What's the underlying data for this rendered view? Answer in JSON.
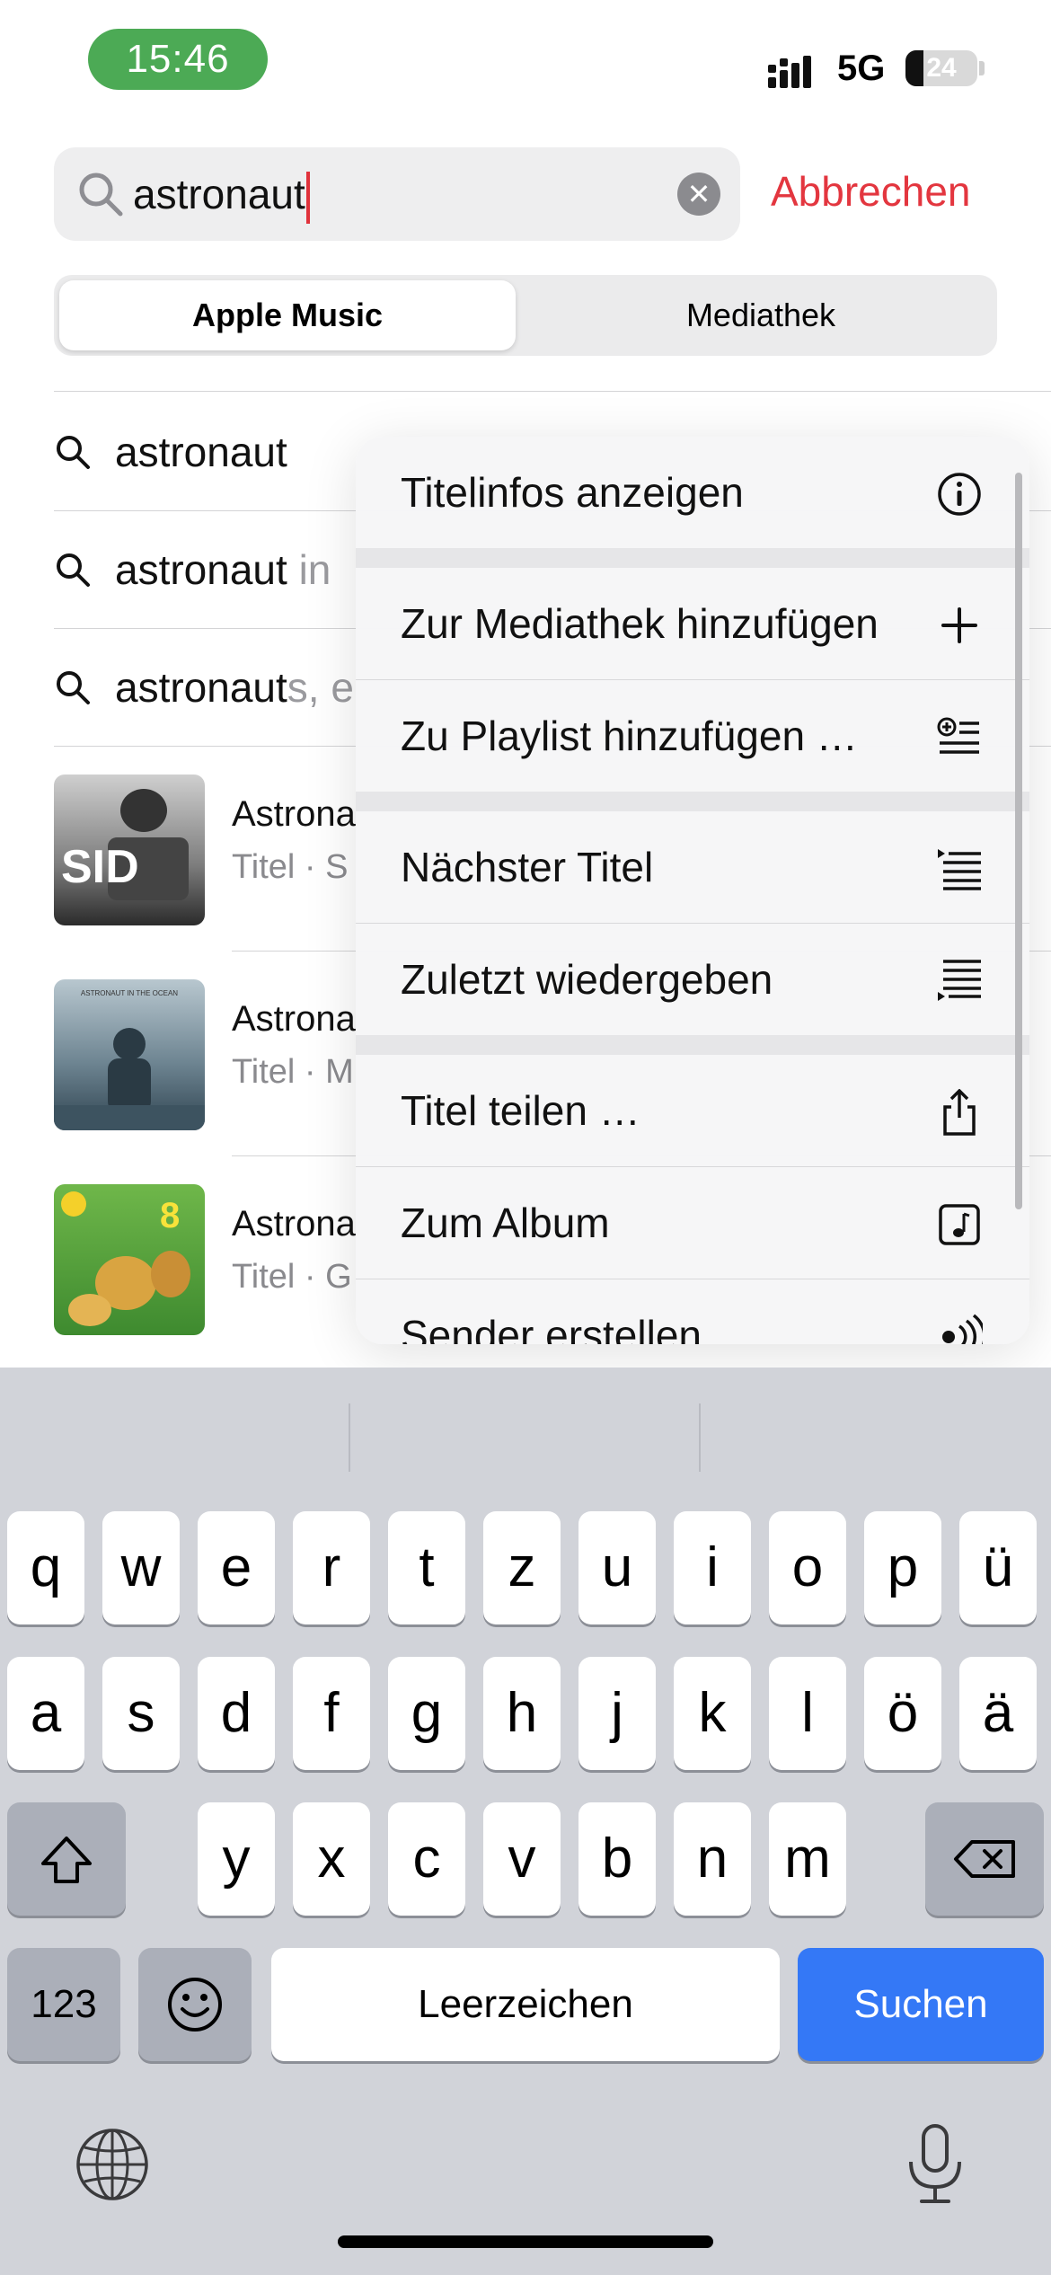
{
  "status_bar": {
    "time": "15:46",
    "network": "5G",
    "battery": "24"
  },
  "search": {
    "value": "astronaut",
    "clear_icon": "clear-icon",
    "cancel_label": "Abbrechen"
  },
  "segments": {
    "active": "Apple Music",
    "inactive": "Mediathek"
  },
  "suggestions": [
    {
      "match": "astronaut",
      "rest": ""
    },
    {
      "match": "astronaut",
      "rest": " in"
    },
    {
      "match": "astronaut",
      "rest": "s, e"
    }
  ],
  "songs": [
    {
      "title": "Astrona",
      "subtitle": "Titel · S",
      "art_text": "SID"
    },
    {
      "title": "Astrona",
      "subtitle": "Titel · M",
      "art_text": "ASTRONAUT IN THE OCEAN"
    },
    {
      "title": "Astrona",
      "subtitle": "Titel · G",
      "art_text": "8"
    }
  ],
  "menu": {
    "items": [
      {
        "label": "Titelinfos anzeigen",
        "icon": "info-icon"
      },
      {
        "label": "Zur Mediathek hinzufügen",
        "icon": "plus-icon"
      },
      {
        "label": "Zu Playlist hinzufügen …",
        "icon": "add-to-playlist-icon"
      },
      {
        "label": "Nächster Titel",
        "icon": "play-next-icon"
      },
      {
        "label": "Zuletzt wiedergeben",
        "icon": "play-last-icon"
      },
      {
        "label": "Titel teilen …",
        "icon": "share-icon"
      },
      {
        "label": "Zum Album",
        "icon": "album-icon"
      },
      {
        "label": "Sender erstellen",
        "icon": "station-icon"
      }
    ]
  },
  "keyboard": {
    "row1": [
      "q",
      "w",
      "e",
      "r",
      "t",
      "z",
      "u",
      "i",
      "o",
      "p",
      "ü"
    ],
    "row2": [
      "a",
      "s",
      "d",
      "f",
      "g",
      "h",
      "j",
      "k",
      "l",
      "ö",
      "ä"
    ],
    "row3": [
      "y",
      "x",
      "c",
      "v",
      "b",
      "n",
      "m"
    ],
    "numbers_label": "123",
    "space_label": "Leerzeichen",
    "return_label": "Suchen"
  },
  "colors": {
    "accent": "#e3363f",
    "time_pill": "#4caa55",
    "return_key": "#3478f6"
  }
}
